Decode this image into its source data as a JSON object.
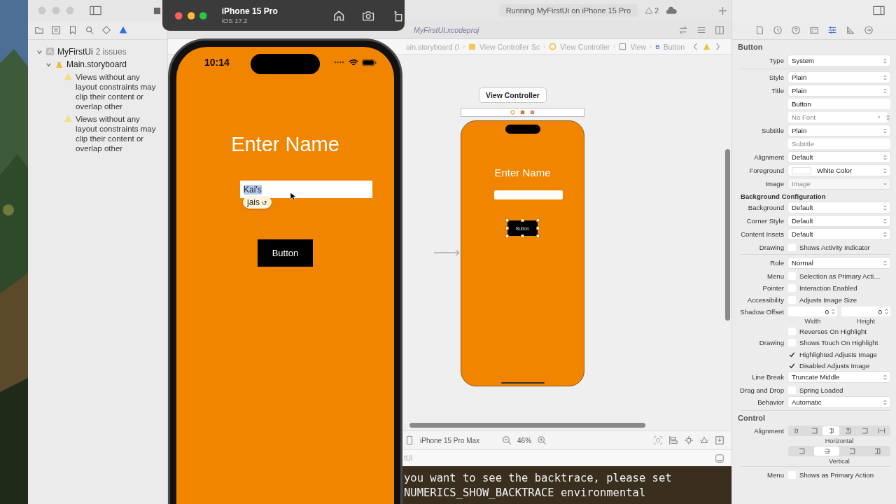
{
  "toolbar": {
    "status": "Running MyFirstUi on iPhone 15 Pro",
    "warnings": "2"
  },
  "navigator": {
    "items": [
      {
        "label": "MyFirstUi",
        "note": "2 issues",
        "kind": "project",
        "expanded": true,
        "children": [
          {
            "label": "Main.storyboard",
            "kind": "storyboard",
            "expanded": true,
            "children": [
              {
                "label": "Views without any layout constraints may clip their content or overlap other",
                "kind": "warning"
              },
              {
                "label": "Views without any layout constraints may clip their content or overlap other",
                "kind": "warning"
              }
            ]
          }
        ]
      }
    ]
  },
  "editor_tabs": [
    {
      "label": "MyFirstUI.xcodeproj",
      "selected": false
    }
  ],
  "jump_bar": [
    {
      "label": "ain.storyboard (I",
      "kind": "file"
    },
    {
      "label": "View Controller Sc",
      "kind": "scene"
    },
    {
      "label": "View Controller",
      "kind": "controller"
    },
    {
      "label": "View",
      "kind": "view"
    },
    {
      "label": "Button",
      "kind": "button",
      "glyph": "B"
    }
  ],
  "canvas": {
    "scene_title": "View Controller",
    "screen_title": "Enter Name",
    "button": "Button"
  },
  "canvas_bar": {
    "device": "iPhone 15 Pro Max",
    "zoom": "46%"
  },
  "debug": {
    "target": "tUi",
    "console": [
      "you want to see the backtrace, please set",
      "NUMERICS_SHOW_BACKTRACE environmental"
    ]
  },
  "inspector": {
    "rows": [
      {
        "kind": "heading",
        "text": "Button"
      },
      {
        "kind": "select",
        "label": "Type",
        "value": "System",
        "disabled": false
      },
      {
        "kind": "divider"
      },
      {
        "kind": "select",
        "label": "Style",
        "value": "Plain",
        "disabled": false
      },
      {
        "kind": "select",
        "label": "Title",
        "value": "Plain",
        "disabled": false
      },
      {
        "kind": "field",
        "value": "Button"
      },
      {
        "kind": "font",
        "placeholder": "No Font"
      },
      {
        "kind": "select",
        "label": "Subtitle",
        "value": "Plain",
        "disabled": false
      },
      {
        "kind": "field",
        "placeholder": "Subtitle"
      },
      {
        "kind": "select",
        "label": "Alignment",
        "value": "Default",
        "disabled": false
      },
      {
        "kind": "color",
        "label": "Foreground",
        "value": "White Color"
      },
      {
        "kind": "select",
        "label": "Image",
        "value": "Image",
        "disabled": true
      },
      {
        "kind": "subheading",
        "text": "Background Configuration"
      },
      {
        "kind": "select",
        "label": "Background",
        "value": "Default",
        "disabled": false
      },
      {
        "kind": "select",
        "label": "Corner Style",
        "value": "Default",
        "disabled": false
      },
      {
        "kind": "select",
        "label": "Content Insets",
        "value": "Default",
        "disabled": false
      },
      {
        "kind": "check",
        "label": "Drawing",
        "text": "Shows Activity Indicator",
        "checked": false
      },
      {
        "kind": "divider"
      },
      {
        "kind": "select",
        "label": "Role",
        "value": "Normal",
        "disabled": false
      },
      {
        "kind": "check",
        "label": "Menu",
        "text": "Selection as Primary Acti…",
        "checked": false
      },
      {
        "kind": "check",
        "label": "Pointer",
        "text": "Interaction Enabled",
        "checked": false
      },
      {
        "kind": "check",
        "label": "Accessibility",
        "text": "Adjusts Image Size",
        "checked": false
      },
      {
        "kind": "pair",
        "label": "Shadow Offset",
        "fields": [
          {
            "value": "0",
            "caption": "Width"
          },
          {
            "value": "0",
            "caption": "Height"
          }
        ]
      },
      {
        "kind": "check",
        "text": "Reverses On Highlight",
        "checked": false
      },
      {
        "kind": "check",
        "label": "Drawing",
        "text": "Shows Touch On Highlight",
        "checked": false
      },
      {
        "kind": "check",
        "text": "Highlighted Adjusts Image",
        "checked": true
      },
      {
        "kind": "check",
        "text": "Disabled Adjusts Image",
        "checked": true
      },
      {
        "kind": "select",
        "label": "Line Break",
        "value": "Truncate Middle",
        "disabled": false
      },
      {
        "kind": "check",
        "label": "Drag and Drop",
        "text": "Spring Loaded",
        "checked": false
      },
      {
        "kind": "select",
        "label": "Behavior",
        "value": "Automatic",
        "disabled": false
      },
      {
        "kind": "divider"
      },
      {
        "kind": "section",
        "text": "Control"
      },
      {
        "kind": "segmented",
        "label": "Alignment",
        "caption": "Horizontal",
        "segments": [
          {
            "selected": false
          },
          {
            "selected": false
          },
          {
            "selected": true
          },
          {
            "selected": false
          },
          {
            "selected": false
          },
          {
            "selected": false
          }
        ]
      },
      {
        "kind": "segmented",
        "caption": "Vertical",
        "segments": [
          {
            "selected": false
          },
          {
            "selected": true
          },
          {
            "selected": false
          },
          {
            "selected": false
          }
        ]
      },
      {
        "kind": "divider"
      },
      {
        "kind": "check",
        "label": "Menu",
        "text": "Shows as Primary Action",
        "checked": false
      }
    ]
  },
  "simulator": {
    "device": "iPhone 15 Pro",
    "os": "iOS 17.2",
    "time": "10:14",
    "title": "Enter Name",
    "field_value": "Kai's",
    "suggestion": "jais",
    "suggestion_glyph": "↺",
    "button": "Button"
  }
}
